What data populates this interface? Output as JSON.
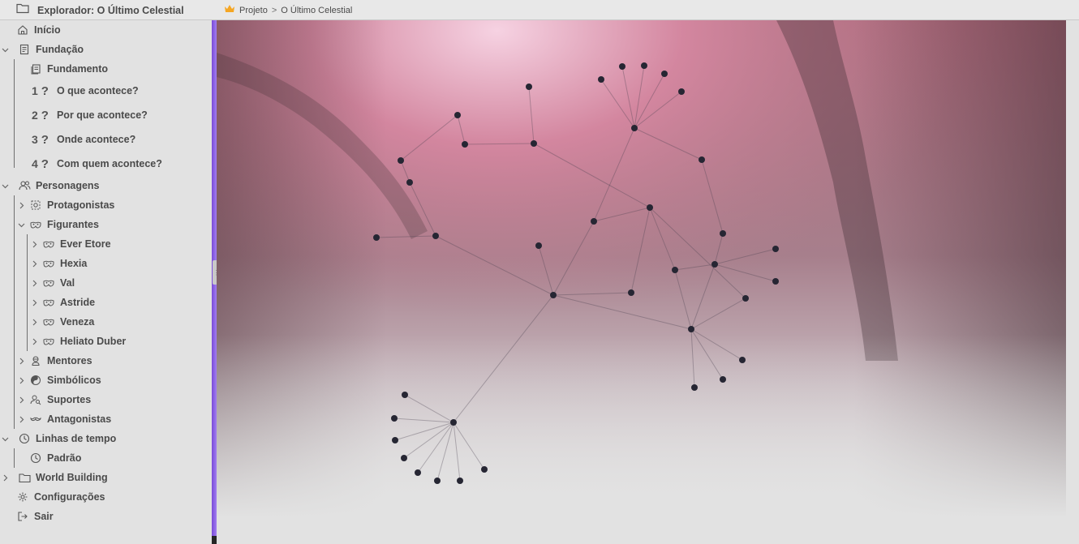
{
  "window": {
    "title": "Explorador: O Último Celestial"
  },
  "breadcrumb": {
    "root": "Projeto",
    "separator": ">",
    "current": "O Último Celestial"
  },
  "sidebar": {
    "home": "Início",
    "foundation": {
      "label": "Fundação",
      "items": [
        {
          "label": "Fundamento"
        },
        {
          "number": "1",
          "label": "O que acontece?"
        },
        {
          "number": "2",
          "label": "Por que acontece?"
        },
        {
          "number": "3",
          "label": "Onde acontece?"
        },
        {
          "number": "4",
          "label": "Com quem acontece?"
        }
      ]
    },
    "characters": {
      "label": "Personagens",
      "protagonists": "Protagonistas",
      "extras": {
        "label": "Figurantes",
        "items": [
          "Ever Etore",
          "Hexia",
          "Val",
          "Astride",
          "Veneza",
          "Heliato Duber"
        ]
      },
      "mentors": "Mentores",
      "symbolic": "Simbólicos",
      "supports": "Suportes",
      "antagonists": "Antagonistas"
    },
    "timelines": {
      "label": "Linhas de tempo",
      "items": [
        "Padrão"
      ]
    },
    "world_building": "World Building",
    "settings": "Configurações",
    "logout": "Sair"
  },
  "colors": {
    "accent": "#8b5cf6",
    "crown": "#f5a623",
    "node": "#262633"
  },
  "icons": [
    "folder-icon",
    "crown-icon",
    "home-icon",
    "book-icon",
    "question-icon",
    "users-icon",
    "clock-icon",
    "gear-icon",
    "logout-icon",
    "chevron-icon",
    "mask-icon"
  ],
  "graph": {
    "node_count": 46
  }
}
